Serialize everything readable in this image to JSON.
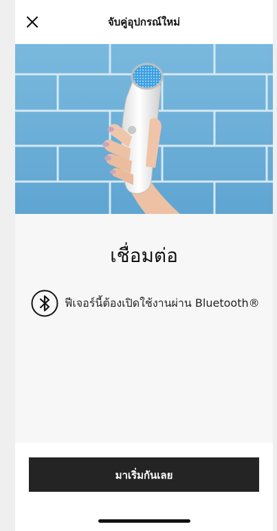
{
  "header": {
    "title": "จับคู่อุปกรณ์ใหม่",
    "close_icon": "close-icon"
  },
  "hero": {
    "description_icon": "device-photo"
  },
  "content": {
    "title": "เชื่อมต่อ",
    "feature_icon": "bluetooth-icon",
    "feature_text": "ฟีเจอร์นี้ต้องเปิดใช้งานผ่าน Bluetooth®"
  },
  "footer": {
    "start_button_label": "มาเริ่มกันเลย"
  },
  "colors": {
    "button_bg": "#242424",
    "tile_blue": "#6fb1d9",
    "content_bg": "#f7f7f7"
  }
}
